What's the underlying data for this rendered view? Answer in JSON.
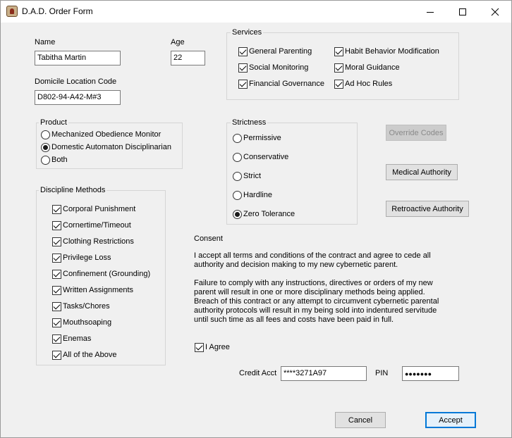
{
  "window": {
    "title": "D.A.D. Order Form",
    "app_icon": "dad-app-icon"
  },
  "fields": {
    "name_label": "Name",
    "name_value": "Tabitha Martin",
    "age_label": "Age",
    "age_value": "22",
    "domicile_label": "Domicile Location Code",
    "domicile_value": "D802-94-A42-M#3"
  },
  "services": {
    "legend": "Services",
    "items": [
      {
        "label": "General Parenting",
        "checked": true
      },
      {
        "label": "Social Monitoring",
        "checked": true
      },
      {
        "label": "Financial Governance",
        "checked": true
      },
      {
        "label": "Habit  Behavior  Modification",
        "checked": true
      },
      {
        "label": "Moral Guidance",
        "checked": true
      },
      {
        "label": "Ad Hoc Rules",
        "checked": true
      }
    ]
  },
  "product": {
    "legend": "Product",
    "options": [
      "Mechanized Obedience Monitor",
      "Domestic Automaton Disciplinarian",
      "Both"
    ],
    "selected": "Domestic Automaton Disciplinarian"
  },
  "strictness": {
    "legend": "Strictness",
    "options": [
      "Permissive",
      "Conservative",
      "Strict",
      "Hardline",
      "Zero Tolerance"
    ],
    "selected": "Zero Tolerance"
  },
  "buttons": {
    "override": "Override Codes",
    "medical": "Medical Authority",
    "retroactive": "Retroactive Authority",
    "cancel": "Cancel",
    "accept": "Accept"
  },
  "discipline": {
    "legend": "Discipline Methods",
    "items": [
      "Corporal Punishment",
      "Cornertime/Timeout",
      "Clothing Restrictions",
      "Privilege Loss",
      "Confinement (Grounding)",
      "Written Assignments",
      "Tasks/Chores",
      "Mouthsoaping",
      "Enemas",
      "All of the Above"
    ]
  },
  "consent": {
    "heading": "Consent",
    "para1_line1": "I accept all terms and conditions of the contract and agree to cede all",
    "para1_line2": "authority and decision making to my new cybernetic parent.",
    "para2_line1": "Failure to comply with any instructions, directives or orders of my new",
    "para2_line2": "parent will result in one or more disciplinary methods being applied.",
    "para2_line3": "Breach of this contract or any attempt to circumvent cybernetic parental",
    "para2_line4": "authority protocols will result in my being sold into indentured servitude",
    "para2_line5": "until such time as all fees and costs have been paid in full.",
    "agree_label": "I Agree"
  },
  "payment": {
    "credit_label": "Credit Acct",
    "credit_value": "****3271A97",
    "pin_label": "PIN",
    "pin_value": "●●●●●●●"
  }
}
